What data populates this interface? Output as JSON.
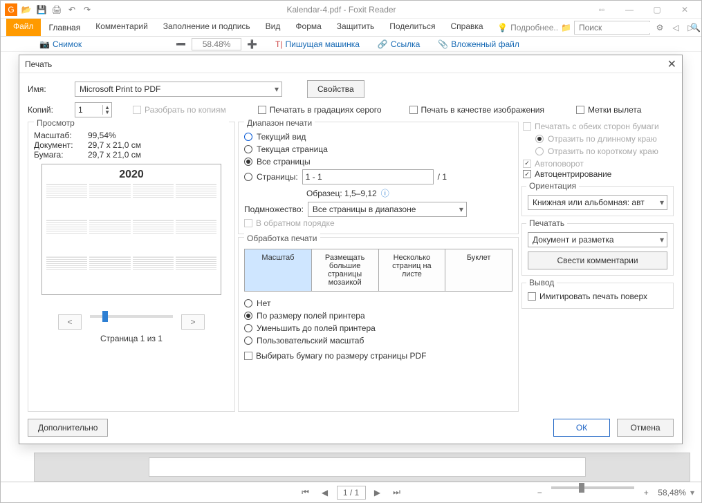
{
  "title": "Kalendar-4.pdf - Foxit Reader",
  "ribbon": {
    "tabs": [
      "Файл",
      "Главная",
      "Комментарий",
      "Заполнение и подпись",
      "Вид",
      "Форма",
      "Защитить",
      "Поделиться",
      "Справка"
    ],
    "more": "Подробнее..",
    "search_placeholder": "Поиск",
    "body": {
      "snapshot": "Снимок",
      "zoom": "58.48%",
      "typewriter": "Пишущая машинка",
      "link": "Ссылка",
      "attach": "Вложенный файл"
    }
  },
  "dialog": {
    "title": "Печать",
    "name_label": "Имя:",
    "printer": "Microsoft Print to PDF",
    "properties": "Свойства",
    "copies_label": "Копий:",
    "copies": "1",
    "collate": "Разобрать по копиям",
    "grayscale": "Печатать в градациях серого",
    "as_image": "Печать в качестве изображения",
    "bleed": "Метки вылета",
    "preview": {
      "legend": "Просмотр",
      "scale_label": "Масштаб:",
      "scale": "99,54%",
      "doc_label": "Документ:",
      "doc": "29,7 x 21,0 см",
      "paper_label": "Бумага:",
      "paper": "29,7 x 21,0 см",
      "year": "2020",
      "page_caption": "Страница 1 из 1"
    },
    "range": {
      "legend": "Диапазон печати",
      "current_view": "Текущий вид",
      "current_page": "Текущая страница",
      "all_pages": "Все страницы",
      "pages_label": "Страницы:",
      "pages_value": "1 - 1",
      "pages_total": "/ 1",
      "sample": "Образец: 1,5–9,12",
      "subset_label": "Подмножество:",
      "subset_value": "Все страницы в диапазоне",
      "reverse": "В обратном порядке"
    },
    "handling": {
      "legend": "Обработка печати",
      "tab_scale": "Масштаб",
      "tab_tile": "Размещать большие страницы мозаикой",
      "tab_multi": "Несколько страниц на листе",
      "tab_booklet": "Буклет",
      "r_none": "Нет",
      "r_fit": "По размеру полей принтера",
      "r_shrink": "Уменьшить до полей принтера",
      "r_custom": "Пользовательский масштаб",
      "choose_paper": "Выбирать бумагу по размеру страницы PDF"
    },
    "options": {
      "duplex": "Печатать с обеих сторон бумаги",
      "flip_long": "Отразить по длинному краю",
      "flip_short": "Отразить по короткому краю",
      "autorotate": "Автоповорот",
      "autocenter": "Автоцентрирование"
    },
    "orientation": {
      "legend": "Ориентация",
      "value": "Книжная или альбомная: авт"
    },
    "print_what": {
      "legend": "Печатать",
      "value": "Документ и разметка",
      "summarize": "Свести комментарии"
    },
    "output": {
      "legend": "Вывод",
      "simulate": "Имитировать печать поверх"
    },
    "advanced": "Дополнительно",
    "ok": "ОК",
    "cancel": "Отмена"
  },
  "status": {
    "page": "1 / 1",
    "zoom": "58,48%"
  }
}
